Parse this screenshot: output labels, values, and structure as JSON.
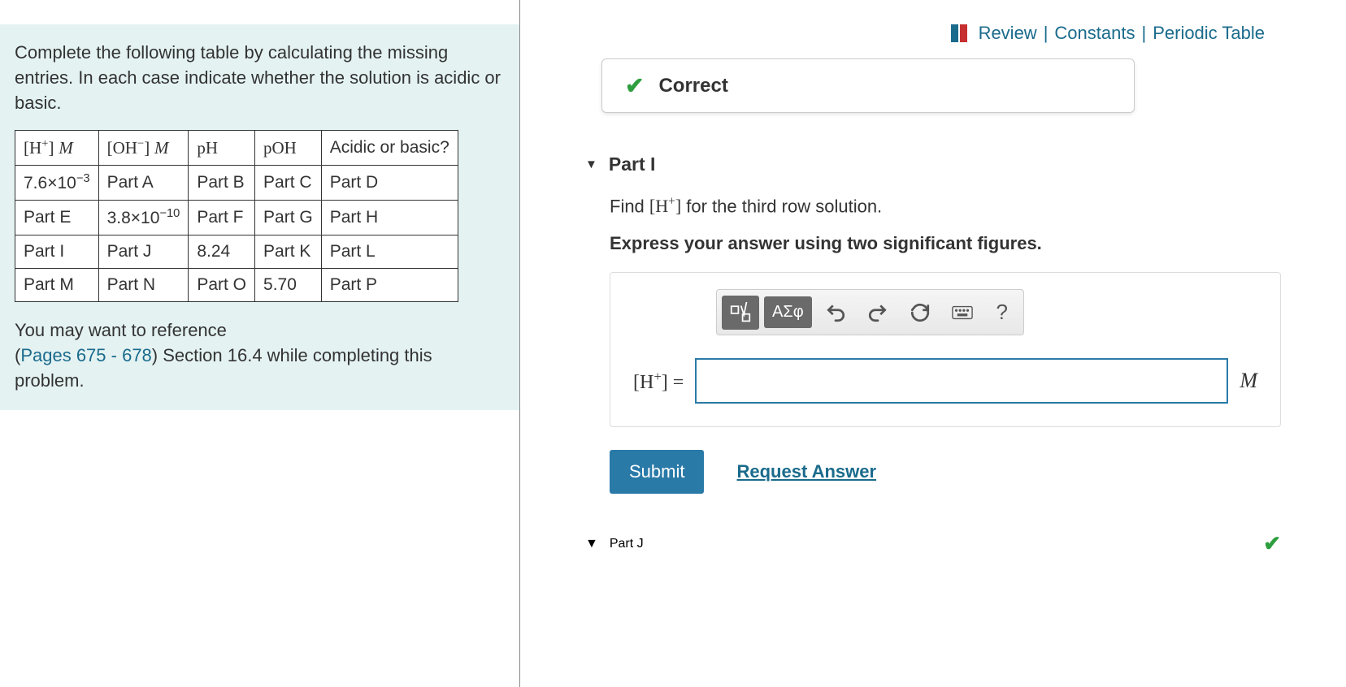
{
  "top_links": {
    "review": "Review",
    "constants": "Constants",
    "periodic": "Periodic Table"
  },
  "problem": {
    "intro": "Complete the following table by calculating the missing entries. In each case indicate whether the solution is acidic or basic.",
    "reference_pre": "You may want to reference",
    "reference_link": "Pages 675 - 678",
    "reference_post": " Section 16.4 while completing this problem."
  },
  "table": {
    "headers": {
      "h_plus": "[H⁺] M",
      "oh_minus": "[OH⁻] M",
      "ph": "pH",
      "poh": "pOH",
      "acidic": "Acidic or basic?"
    },
    "rows": [
      {
        "c0": "7.6×10⁻³",
        "c1": "Part A",
        "c2": "Part B",
        "c3": "Part C",
        "c4": "Part D"
      },
      {
        "c0": "Part E",
        "c1": "3.8×10⁻¹⁰",
        "c2": "Part F",
        "c3": "Part G",
        "c4": "Part H"
      },
      {
        "c0": "Part I",
        "c1": "Part J",
        "c2": "8.24",
        "c3": "Part K",
        "c4": "Part L"
      },
      {
        "c0": "Part M",
        "c1": "Part N",
        "c2": "Part O",
        "c3": "5.70",
        "c4": "Part P"
      }
    ]
  },
  "feedback": {
    "correct": "Correct"
  },
  "partI": {
    "title": "Part I",
    "question_pre": "Find ",
    "question_expr": "[H⁺]",
    "question_post": " for the third row solution.",
    "instruction": "Express your answer using two significant figures.",
    "answer_label_expr": "[H⁺] =",
    "unit": "M",
    "answer_value": ""
  },
  "toolbar": {
    "greek": "ΑΣφ",
    "help": "?"
  },
  "buttons": {
    "submit": "Submit",
    "request": "Request Answer"
  },
  "partJ": {
    "title": "Part J"
  }
}
